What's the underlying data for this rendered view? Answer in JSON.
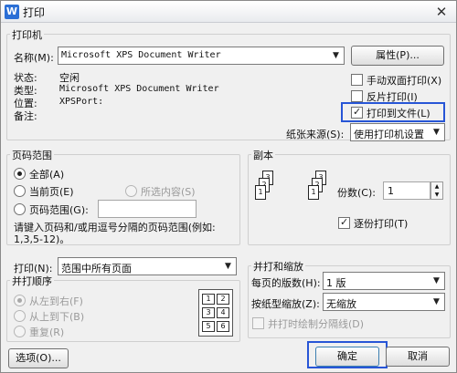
{
  "window": {
    "title": "打印",
    "app_icon": "W",
    "close_glyph": "✕"
  },
  "printer": {
    "group_label": "打印机",
    "name_label": "名称(M):",
    "name_value": "Microsoft XPS Document Writer",
    "properties_button": "属性(P)...",
    "status_label": "状态:",
    "status_value": "空闲",
    "type_label": "类型:",
    "type_value": "Microsoft XPS Document Writer",
    "location_label": "位置:",
    "location_value": "XPSPort:",
    "comment_label": "备注:",
    "manual_duplex": "手动双面打印(X)",
    "reverse_print": "反片打印(I)",
    "print_to_file": "打印到文件(L)",
    "paper_source_label": "纸张来源(S):",
    "paper_source_value": "使用打印机设置"
  },
  "range": {
    "group_label": "页码范围",
    "all": "全部(A)",
    "current": "当前页(E)",
    "selection": "所选内容(S)",
    "pages": "页码范围(G):",
    "pages_value": "",
    "hint_line1": "请键入页码和/或用逗号分隔的页码范围(例如:",
    "hint_line2": "1,3,5-12)。"
  },
  "copies": {
    "group_label": "副本",
    "count_label": "份数(C):",
    "count_value": "1",
    "collate": "逐份打印(T)",
    "page_nums": [
      "1",
      "2",
      "3"
    ]
  },
  "print_what": {
    "label": "打印(N):",
    "value": "范围中所有页面"
  },
  "order": {
    "group_label": "并打顺序",
    "left_to_right": "从左到右(F)",
    "top_to_bottom": "从上到下(B)",
    "repeat": "重复(R)",
    "grid": [
      "1",
      "2",
      "3",
      "4",
      "5",
      "6"
    ]
  },
  "zoom": {
    "group_label": "并打和缩放",
    "pages_per_sheet_label": "每页的版数(H):",
    "pages_per_sheet_value": "1 版",
    "scale_label": "按纸型缩放(Z):",
    "scale_value": "无缩放",
    "draw_divider": "并打时绘制分隔线(D)"
  },
  "footer": {
    "options_button": "选项(O)...",
    "ok_button": "确定",
    "cancel_button": "取消"
  }
}
